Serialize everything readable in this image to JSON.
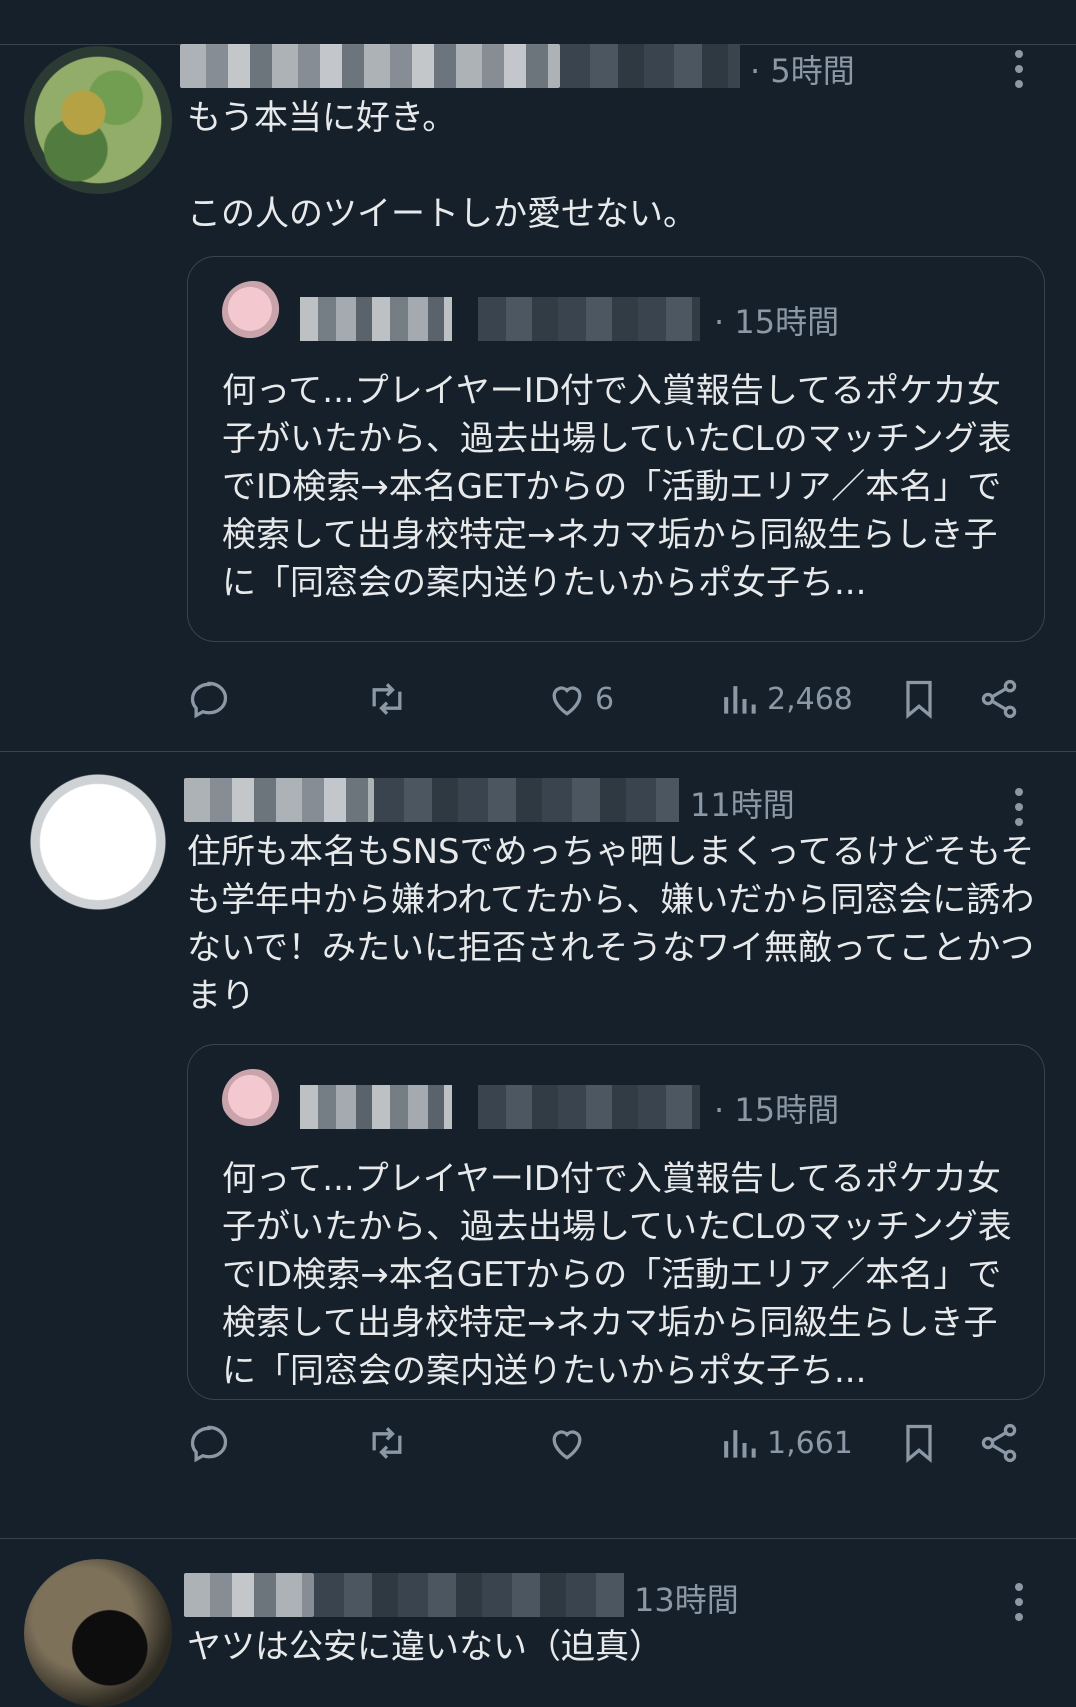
{
  "tweets": [
    {
      "time": "· 5時間",
      "text": "もう本当に好き。\n\nこの人のツイートしか愛せない。",
      "quote": {
        "time": "· 15時間",
        "text": "何って...プレイヤーID付で入賞報告してるポケカ女子がいたから、過去出場していたCLのマッチング表でID検索→本名GETからの「活動エリア／本名」で検索して出身校特定→ネカマ垢から同級生らしき子に「同窓会の案内送りたいからポ女子ち..."
      },
      "likes": "6",
      "views": "2,468",
      "icons": [
        "reply-icon",
        "retweet-icon",
        "like-icon",
        "views-icon",
        "bookmark-icon",
        "share-icon",
        "more-icon"
      ]
    },
    {
      "time": "11時間",
      "text": "住所も本名もSNSでめっちゃ晒しまくってるけどそもそも学年中から嫌われてたから、嫌いだから同窓会に誘わないで！みたいに拒否されそうなワイ無敵ってことかつまり",
      "quote": {
        "time": "· 15時間",
        "text": "何って...プレイヤーID付で入賞報告してるポケカ女子がいたから、過去出場していたCLのマッチング表でID検索→本名GETからの「活動エリア／本名」で検索して出身校特定→ネカマ垢から同級生らしき子に「同窓会の案内送りたいからポ女子ち..."
      },
      "likes": "",
      "views": "1,661"
    },
    {
      "time": "13時間",
      "text": "ヤツは公安に違いない（迫真）"
    }
  ],
  "colors": {
    "background": "#15202b",
    "text": "#e7e9ea",
    "muted": "#8b98a5",
    "border": "#38444d"
  }
}
